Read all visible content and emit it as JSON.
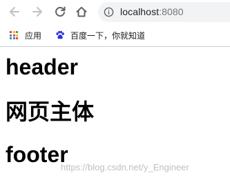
{
  "address_bar": {
    "url_host": "localhost",
    "url_port": ":8080"
  },
  "bookmarks": [
    {
      "label": "应用",
      "icon": "apps-grid-icon"
    },
    {
      "label": "百度一下，你就知道",
      "icon": "baidu-paw-icon"
    }
  ],
  "page": {
    "header": "header",
    "main": "网页主体",
    "footer": "footer"
  },
  "watermark": "https://blog.csdn.net/y_Engineer",
  "colors": {
    "apps_grid": [
      "#ea4335",
      "#fbbc05",
      "#34a853",
      "#4285f4",
      "#ea4335",
      "#fbbc05",
      "#34a853",
      "#4285f4",
      "#ea4335"
    ],
    "baidu_blue": "#2932e1",
    "nav_disabled": "#bdc1c6",
    "nav_active": "#5f6368"
  }
}
